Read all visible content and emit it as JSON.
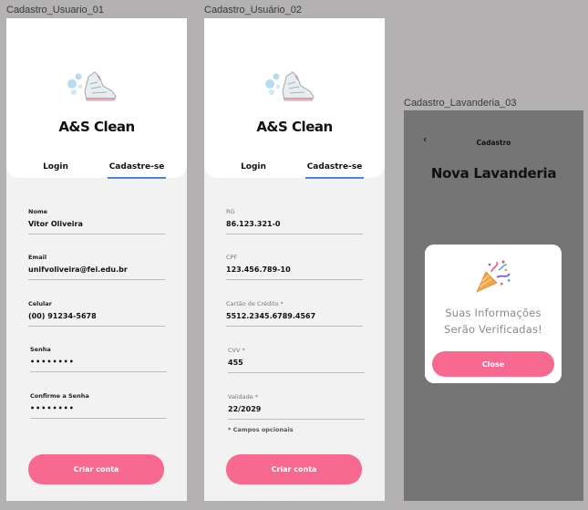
{
  "frames": [
    {
      "title": "Cadastro_Usuario_01",
      "brand": "A&S Clean",
      "tabs": {
        "login": "Login",
        "signup": "Cadastre-se"
      },
      "fields": [
        {
          "label": "Nome",
          "value": "Vitor Oliveira"
        },
        {
          "label": "Email",
          "value": "unifvoliveira@fei.edu.br"
        },
        {
          "label": "Celular",
          "value": "(00) 91234-5678"
        },
        {
          "label": "Senha",
          "value": "••••••••"
        },
        {
          "label": "Confirme a Senha",
          "value": "••••••••"
        }
      ],
      "button": "Criar conta"
    },
    {
      "title": "Cadastro_Usuário_02",
      "brand": "A&S Clean",
      "tabs": {
        "login": "Login",
        "signup": "Cadastre-se"
      },
      "fields": [
        {
          "label": "RG",
          "value": "86.123.321-0"
        },
        {
          "label": "CPF",
          "value": "123.456.789-10"
        },
        {
          "label": "Cartão de Crédito *",
          "value": "5512.2345.6789.4567"
        },
        {
          "label": "CVV *",
          "value": "455"
        },
        {
          "label": "Validade *",
          "value": "22/2029"
        }
      ],
      "note": "* Campos opcionais",
      "button": "Criar conta"
    },
    {
      "title": "Cadastro_Lavanderia_03",
      "header": "Cadastro",
      "heading": "Nova Lavanderia",
      "modal": {
        "line1": "Suas Informações",
        "line2": "Serão Verificadas!",
        "button": "Close"
      }
    }
  ],
  "icons": {
    "back": "chevron-left-icon",
    "logo": "sneaker-bubbles-icon",
    "party": "party-popper-icon"
  },
  "colors": {
    "accent": "#f8698f",
    "tab_underline": "#4a86d8",
    "canvas": "#b3b1b2",
    "overlay": "#757575"
  }
}
